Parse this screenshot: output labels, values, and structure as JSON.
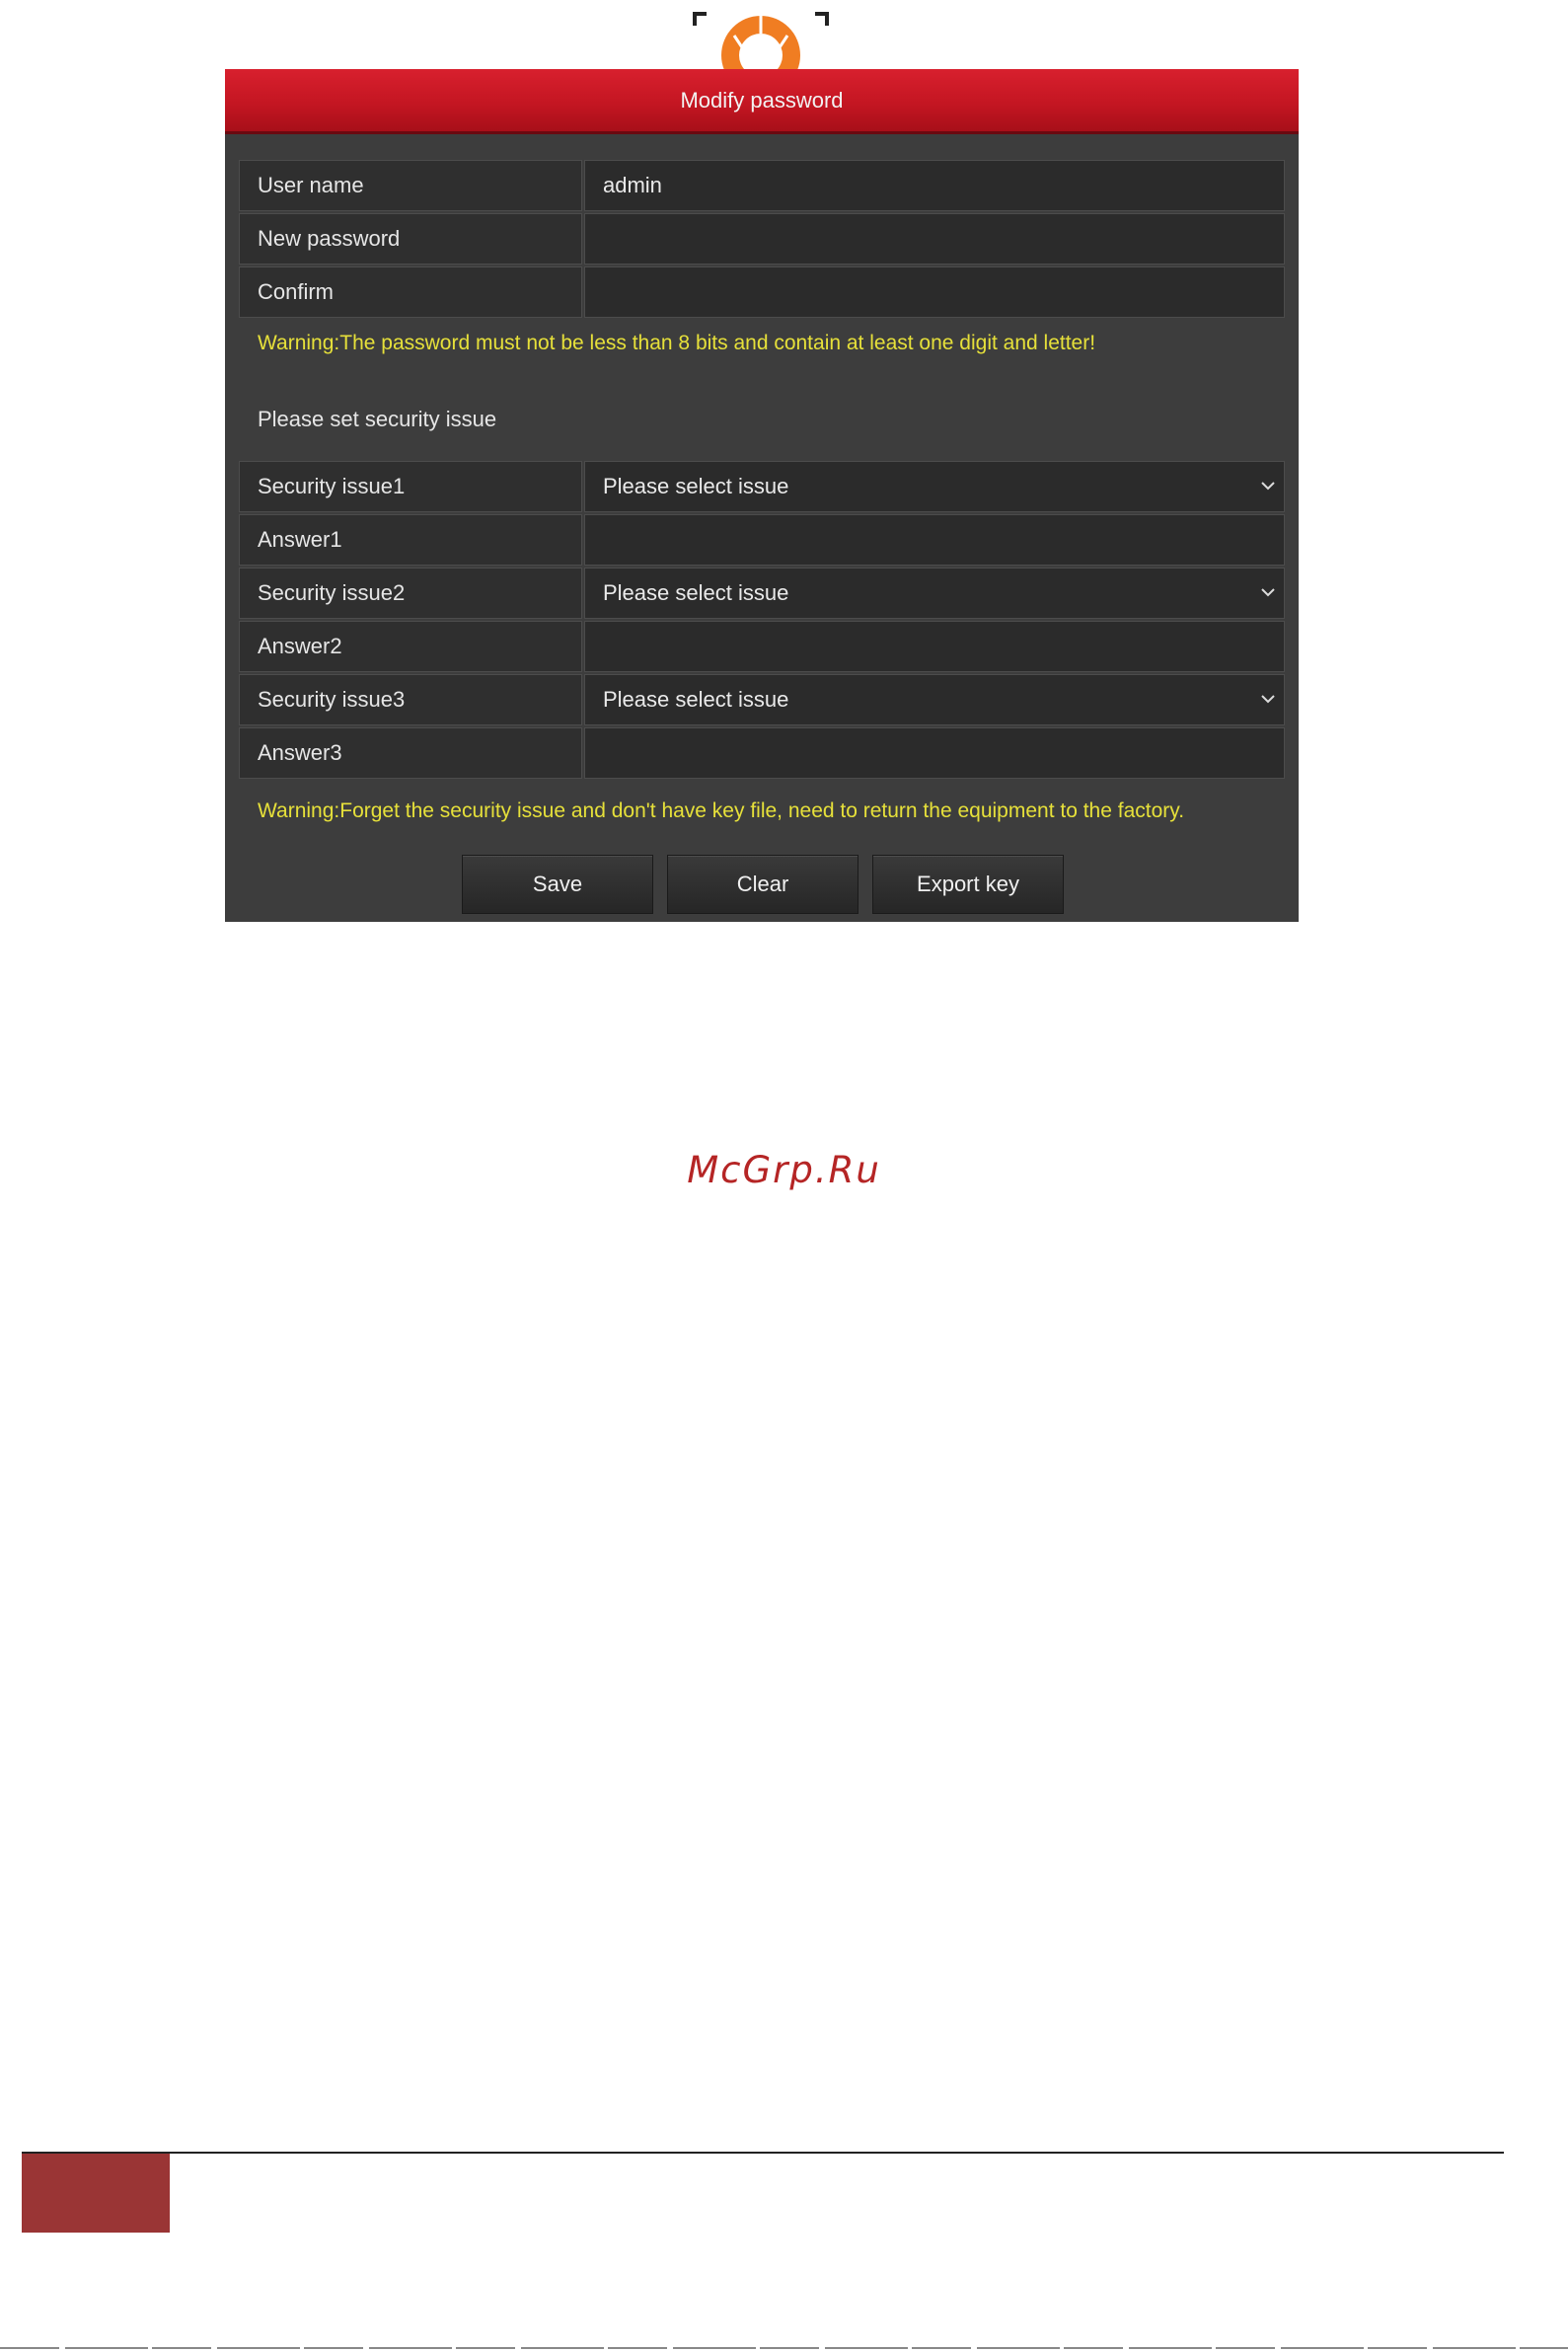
{
  "dialog": {
    "title": "Modify password"
  },
  "account_fields": [
    {
      "label": "User name",
      "value": "admin"
    },
    {
      "label": "New password",
      "value": ""
    },
    {
      "label": "Confirm",
      "value": ""
    }
  ],
  "warning_password": "Warning:The password must not be less than 8 bits and contain at least one digit and letter!",
  "security_section_title": "Please set security issue",
  "security_fields": [
    {
      "label": "Security issue1",
      "value": "Please select issue",
      "type": "select"
    },
    {
      "label": "Answer1",
      "value": "",
      "type": "input"
    },
    {
      "label": "Security issue2",
      "value": "Please select issue",
      "type": "select"
    },
    {
      "label": "Answer2",
      "value": "",
      "type": "input"
    },
    {
      "label": "Security issue3",
      "value": "Please select issue",
      "type": "select"
    },
    {
      "label": "Answer3",
      "value": "",
      "type": "input"
    }
  ],
  "warning_security": "Warning:Forget the security issue and don't have key file, need to return the equipment to the factory.",
  "buttons": {
    "save": "Save",
    "clear": "Clear",
    "export_key": "Export key"
  },
  "watermark": "McGrp.Ru",
  "colors": {
    "titlebar": "#c41622",
    "dialog_bg": "#3d3d3d",
    "warning_text": "#e6e03a",
    "watermark": "#b52525",
    "logo_orange": "#f07d22"
  },
  "icons": {
    "logo": "aperture-logo-icon",
    "dropdown": "chevron-down-icon"
  }
}
